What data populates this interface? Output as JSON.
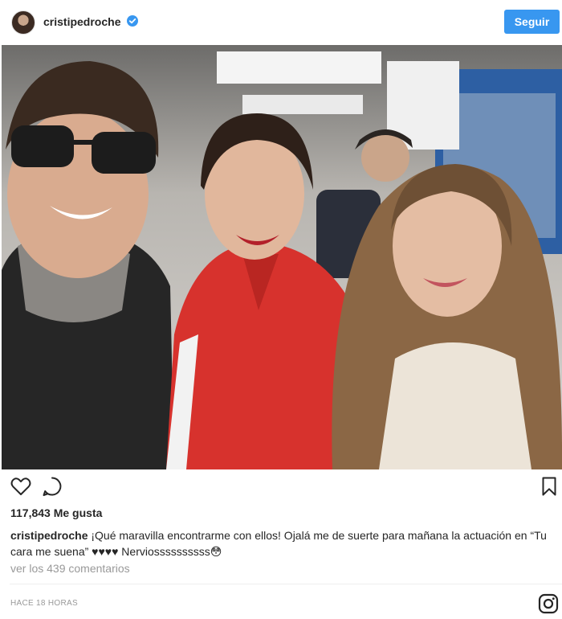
{
  "header": {
    "username": "cristipedroche",
    "verified_icon": "verified-badge-icon",
    "follow_label": "Seguir",
    "accent_color": "#3897f0"
  },
  "actions": {
    "like_icon": "heart-icon",
    "comment_icon": "comment-bubble-icon",
    "save_icon": "bookmark-icon"
  },
  "post": {
    "likes": "117,843 Me gusta",
    "caption_user": "cristipedroche",
    "caption_text": " ¡Qué maravilla encontrarme con ellos! Ojalá me de suerte para mañana la actuación en “Tu cara me suena” ♥♥♥♥ Nerviossssssssss😳",
    "comments_link": "ver los 439 comentarios",
    "timestamp": "HACE 18 HORAS"
  },
  "footer": {
    "logo_icon": "instagram-logo-icon"
  }
}
